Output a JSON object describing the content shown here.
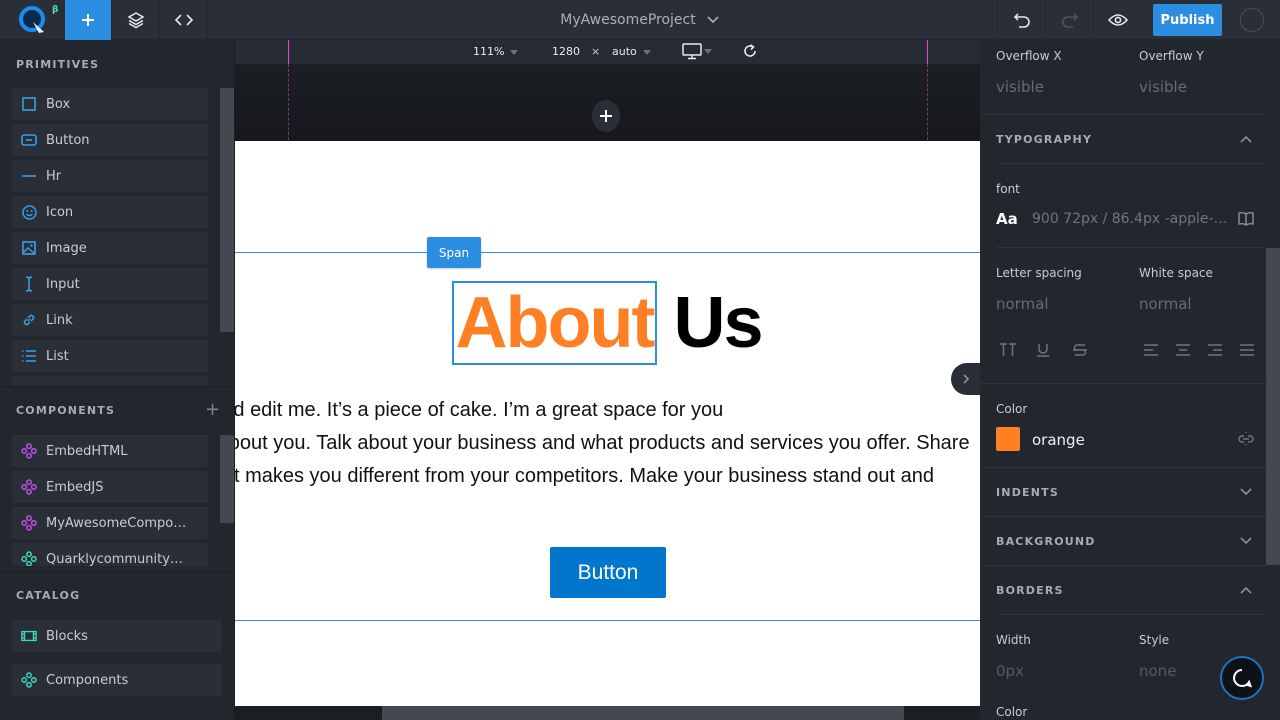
{
  "topbar": {
    "beta_badge": "β",
    "project_name": "MyAwesomeProject",
    "publish_label": "Publish"
  },
  "canvas_toolbar": {
    "zoom": "111%",
    "width": "1280",
    "times": "×",
    "height": "auto"
  },
  "sidebar": {
    "primitives_title": "PRIMITIVES",
    "primitives": [
      {
        "label": "Box",
        "icon": "box-icon"
      },
      {
        "label": "Button",
        "icon": "button-icon"
      },
      {
        "label": "Hr",
        "icon": "hr-icon"
      },
      {
        "label": "Icon",
        "icon": "smiley-icon"
      },
      {
        "label": "Image",
        "icon": "image-icon"
      },
      {
        "label": "Input",
        "icon": "text-cursor-icon"
      },
      {
        "label": "Link",
        "icon": "link-icon"
      },
      {
        "label": "List",
        "icon": "list-icon"
      }
    ],
    "components_title": "COMPONENTS",
    "components_add": "+",
    "components": [
      {
        "label": "EmbedHTML"
      },
      {
        "label": "EmbedJS"
      },
      {
        "label": "MyAwesomeCompo…"
      },
      {
        "label": "Quarklycommunity…"
      }
    ],
    "catalog_title": "CATALOG",
    "catalog": [
      {
        "label": "Blocks"
      },
      {
        "label": "Components"
      }
    ]
  },
  "page": {
    "span_tag": "Span",
    "heading_highlight": "About",
    "heading_rest": " Us",
    "paragraph_lines": [
      "Click here to add your own text and edit me. It’s a piece of cake. I’m a great space for you",
      "to tell a story and let your users know a little more about you. Talk about your business and what products and services you offer. Share",
      "your story and what makes you different from your competitors. Make your business stand out and"
    ],
    "button_label": "Button"
  },
  "props": {
    "overflow_x_label": "Overflow X",
    "overflow_x_value": "visible",
    "overflow_y_label": "Overflow Y",
    "overflow_y_value": "visible",
    "typography_title": "TYPOGRAPHY",
    "font_label": "font",
    "font_aa": "Aa",
    "font_value": "900 72px / 86.4px -apple-…",
    "letter_spacing_label": "Letter spacing",
    "letter_spacing_value": "normal",
    "white_space_label": "White space",
    "white_space_value": "normal",
    "color_label": "Color",
    "color_value": "orange",
    "color_hex": "#ff7f24",
    "indents_title": "INDENTS",
    "background_title": "BACKGROUND",
    "borders_title": "BORDERS",
    "border_width_label": "Width",
    "border_width_value": "0px",
    "border_style_label": "Style",
    "border_style_value": "none",
    "border_color_label": "Color"
  }
}
